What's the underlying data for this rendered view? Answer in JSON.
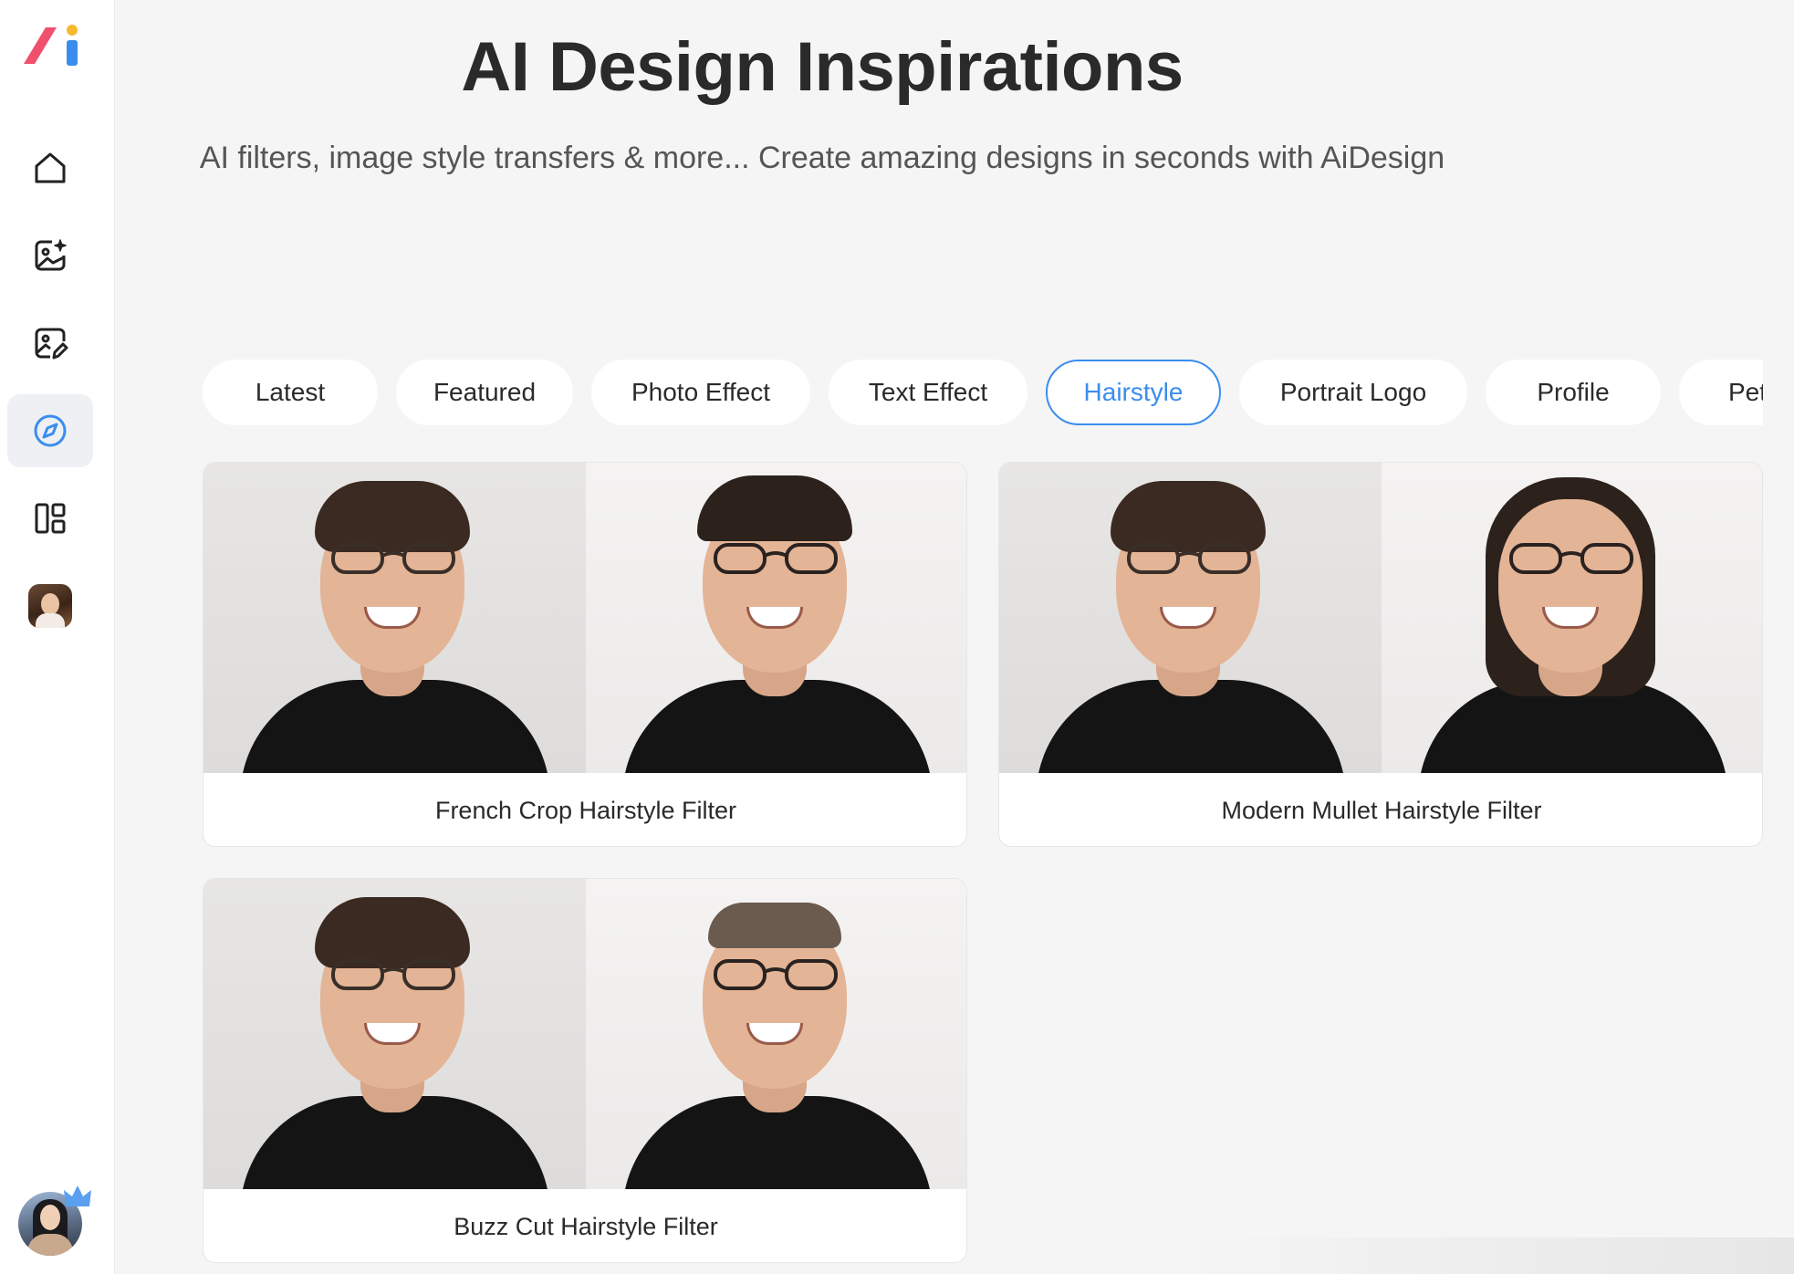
{
  "app": {
    "logo_name": "AiDesign",
    "brand_colors": {
      "slash": "#f0506e",
      "i_dot": "#f5b82e",
      "i_stem": "#3b8ded"
    }
  },
  "sidebar": {
    "items": [
      {
        "name": "home",
        "icon": "home-icon",
        "active": false
      },
      {
        "name": "ai-image",
        "icon": "image-sparkle-icon",
        "active": false
      },
      {
        "name": "image-edit",
        "icon": "image-edit-icon",
        "active": false
      },
      {
        "name": "explore",
        "icon": "compass-icon",
        "active": true
      },
      {
        "name": "templates",
        "icon": "layout-icon",
        "active": false
      },
      {
        "name": "avatar-generator",
        "icon": "portrait-thumbnail",
        "active": false
      }
    ],
    "user": {
      "icon": "user-avatar",
      "badge": "crown-icon"
    }
  },
  "header": {
    "title": "AI Design Inspirations",
    "subtitle": "AI filters, image style transfers & more... Create amazing designs in seconds with AiDesign"
  },
  "tabs": [
    {
      "label": "Latest",
      "active": false
    },
    {
      "label": "Featured",
      "active": false
    },
    {
      "label": "Photo Effect",
      "active": false
    },
    {
      "label": "Text Effect",
      "active": false
    },
    {
      "label": "Hairstyle",
      "active": true
    },
    {
      "label": "Portrait Logo",
      "active": false
    },
    {
      "label": "Profile",
      "active": false
    },
    {
      "label": "Pet",
      "active": false
    }
  ],
  "accent_color": "#3b8ded",
  "cards": [
    {
      "title": "French Crop Hairstyle Filter"
    },
    {
      "title": "Modern Mullet Hairstyle Filter"
    },
    {
      "title": "Buzz Cut Hairstyle Filter"
    }
  ]
}
